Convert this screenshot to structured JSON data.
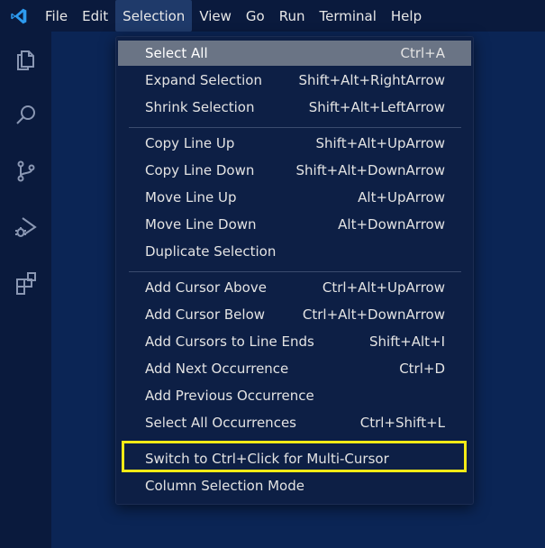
{
  "menubar": {
    "logo_icon": "vscode-logo-icon",
    "items": [
      "File",
      "Edit",
      "Selection",
      "View",
      "Go",
      "Run",
      "Terminal",
      "Help"
    ],
    "active_index": 2
  },
  "activitybar": {
    "icons": [
      "explorer-icon",
      "search-icon",
      "source-control-icon",
      "run-debug-icon",
      "extensions-icon"
    ]
  },
  "dropdown": {
    "groups": [
      [
        {
          "label": "Select All",
          "shortcut": "Ctrl+A",
          "hover": true
        },
        {
          "label": "Expand Selection",
          "shortcut": "Shift+Alt+RightArrow"
        },
        {
          "label": "Shrink Selection",
          "shortcut": "Shift+Alt+LeftArrow"
        }
      ],
      [
        {
          "label": "Copy Line Up",
          "shortcut": "Shift+Alt+UpArrow"
        },
        {
          "label": "Copy Line Down",
          "shortcut": "Shift+Alt+DownArrow"
        },
        {
          "label": "Move Line Up",
          "shortcut": "Alt+UpArrow"
        },
        {
          "label": "Move Line Down",
          "shortcut": "Alt+DownArrow"
        },
        {
          "label": "Duplicate Selection",
          "shortcut": ""
        }
      ],
      [
        {
          "label": "Add Cursor Above",
          "shortcut": "Ctrl+Alt+UpArrow"
        },
        {
          "label": "Add Cursor Below",
          "shortcut": "Ctrl+Alt+DownArrow"
        },
        {
          "label": "Add Cursors to Line Ends",
          "shortcut": "Shift+Alt+I"
        },
        {
          "label": "Add Next Occurrence",
          "shortcut": "Ctrl+D"
        },
        {
          "label": "Add Previous Occurrence",
          "shortcut": ""
        },
        {
          "label": "Select All Occurrences",
          "shortcut": "Ctrl+Shift+L"
        }
      ],
      [
        {
          "label": "Switch to Ctrl+Click for Multi-Cursor",
          "shortcut": "",
          "highlighted": true
        },
        {
          "label": "Column Selection Mode",
          "shortcut": ""
        }
      ]
    ]
  },
  "colors": {
    "highlight_outline": "#f2ea16",
    "hover_bg": "#6a7485",
    "editor_bg": "#0b2555",
    "menubar_bg": "#0a1a3d"
  }
}
